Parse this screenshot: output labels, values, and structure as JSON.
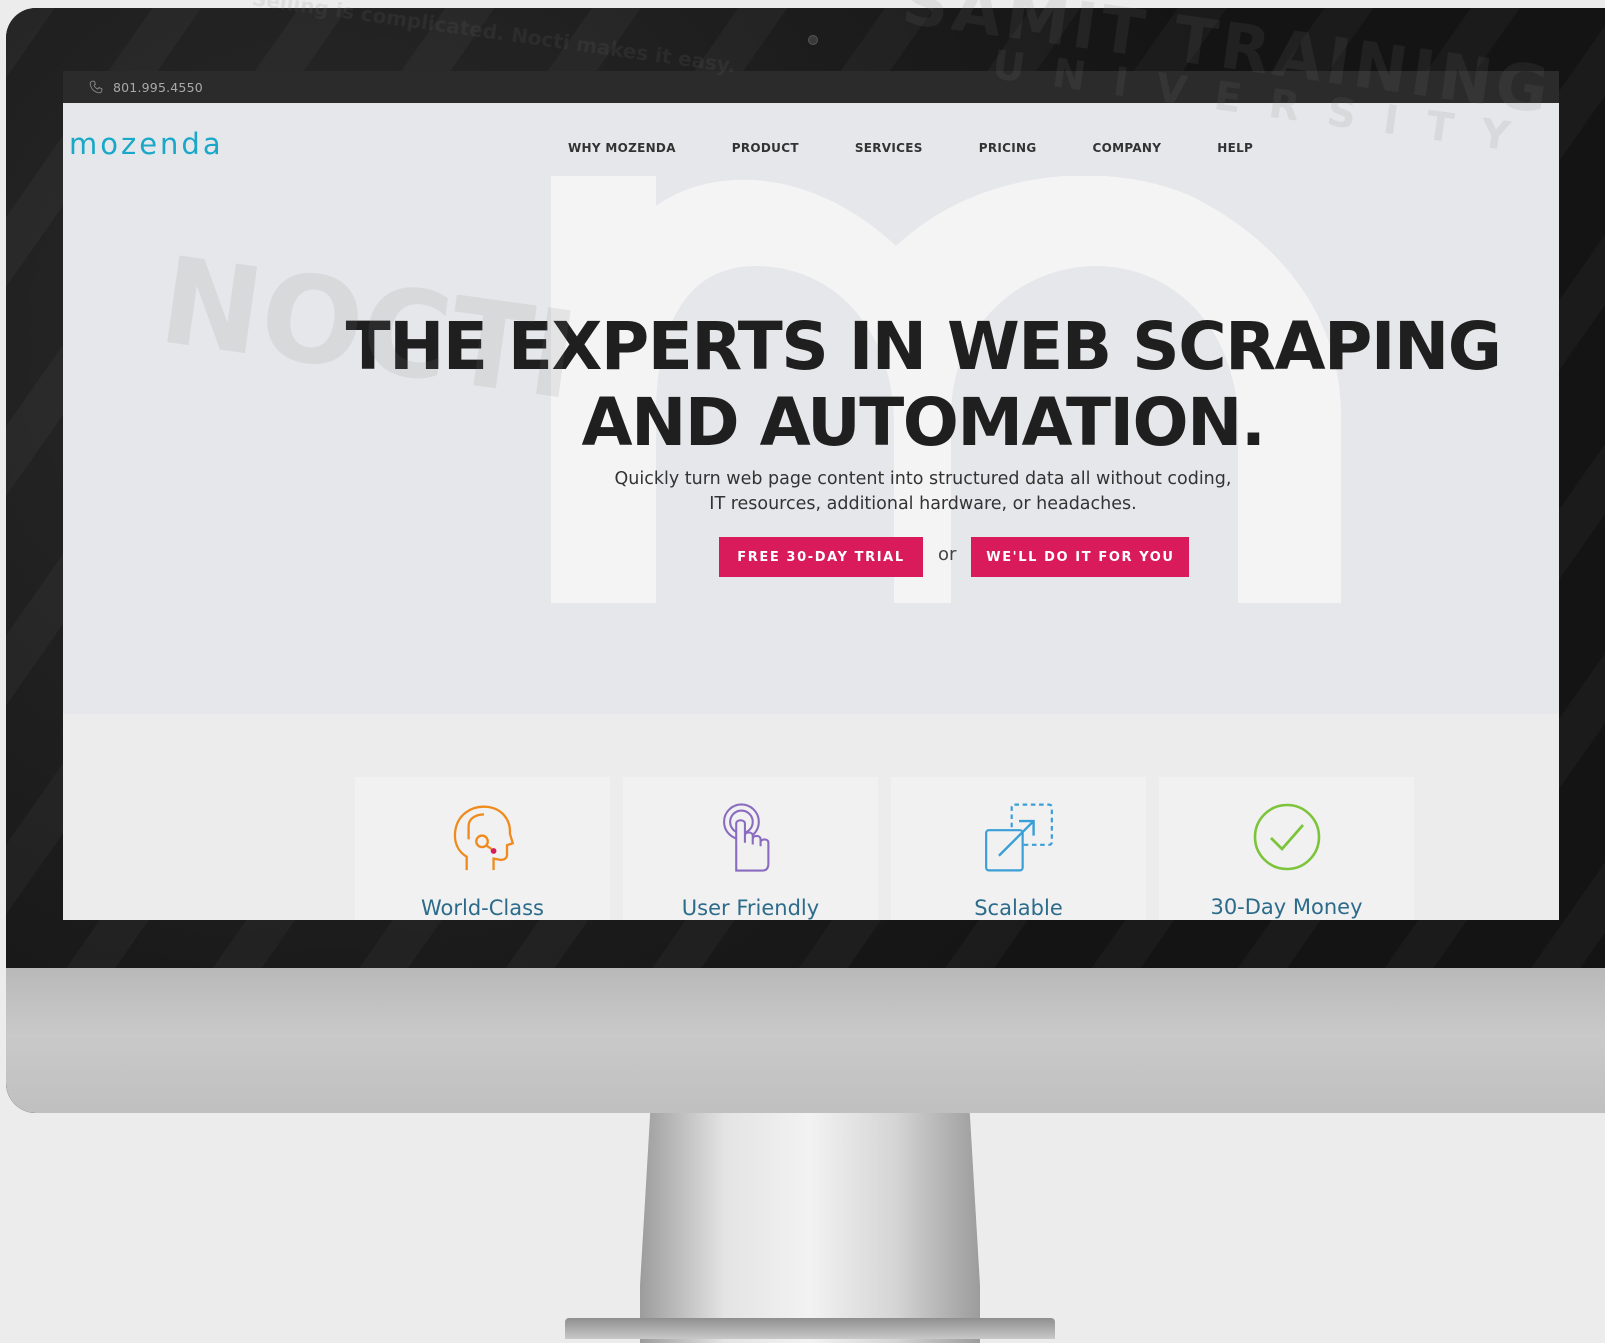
{
  "topbar": {
    "phone": "801.995.4550"
  },
  "brand": {
    "logo": "mozenda",
    "color": "#1aa8c9"
  },
  "nav": {
    "items": [
      "WHY MOZENDA",
      "PRODUCT",
      "SERVICES",
      "PRICING",
      "COMPANY",
      "HELP"
    ]
  },
  "hero": {
    "title_line1": "THE EXPERTS IN WEB SCRAPING",
    "title_line2": "AND AUTOMATION.",
    "subtitle_line1": "Quickly turn web page content into structured data all without coding,",
    "subtitle_line2": "IT resources, additional hardware, or headaches.",
    "cta_trial": "FREE 30-DAY TRIAL",
    "cta_or": "or",
    "cta_service": "WE'LL DO IT FOR YOU",
    "accent": "#d91b5c"
  },
  "features": [
    {
      "label": "World-Class",
      "icon": "head-support-icon",
      "color": "#f08a1c"
    },
    {
      "label": "User Friendly",
      "icon": "touch-tap-icon",
      "color": "#8a6bbf"
    },
    {
      "label": "Scalable",
      "icon": "expand-arrow-icon",
      "color": "#3a9fd6"
    },
    {
      "label": "30-Day Money",
      "icon": "check-circle-icon",
      "color": "#7cc43a"
    }
  ],
  "watermark": {
    "lines": [
      "SAMIT TRAINING",
      "UNIVERSITY",
      "NOCTI",
      "Selling is complicated. Nocti makes it easy."
    ]
  }
}
